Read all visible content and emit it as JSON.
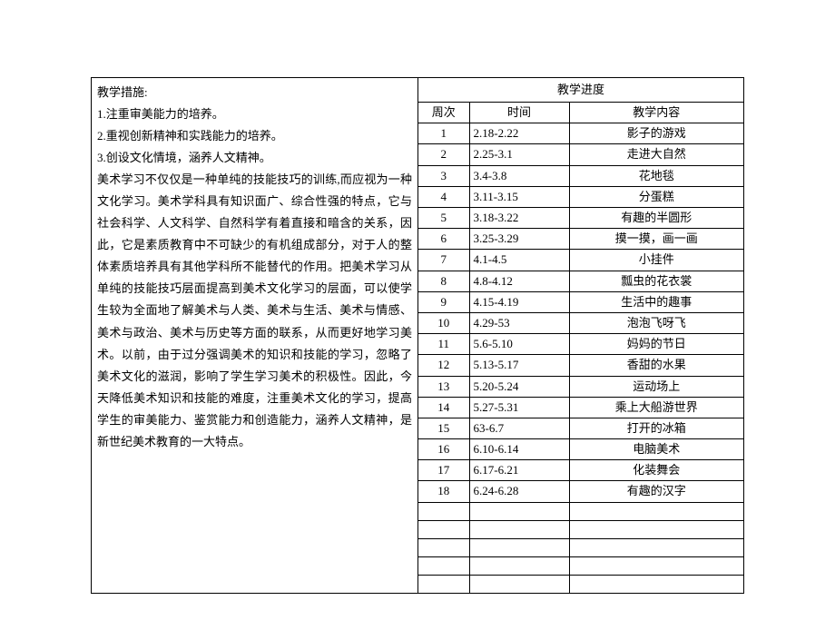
{
  "left": {
    "heading": "教学措施:",
    "point1": "1.注重审美能力的培养。",
    "point2": "2.重视创新精神和实践能力的培养。",
    "point3": "3.创设文化情境，涵养人文精神。",
    "para": "美术学习不仅仅是一种单纯的技能技巧的训练,而应视为一种文化学习。美术学科具有知识面广、综合性强的特点，它与社会科学、人文科学、自然科学有着直接和暗含的关系，因此，它是素质教育中不可缺少的有机组成部分，对于人的整体素质培养具有其他学科所不能替代的作用。把美术学习从单纯的技能技巧层面提高到美术文化学习的层面，可以使学生较为全面地了解美术与人类、美术与生活、美术与情感、美术与政治、美术与历史等方面的联系，从而更好地学习美术。以前，由于过分强调美术的知识和技能的学习，忽略了美术文化的滋润，影响了学生学习美术的积极性。因此，今天降低美术知识和技能的难度，注重美术文化的学习，提高学生的审美能力、鉴赏能力和创造能力，涵养人文精神，是新世纪美术教育的一大特点。"
  },
  "schedule": {
    "title": "教学进度",
    "headers": {
      "week": "周次",
      "time": "时间",
      "content": "教学内容"
    },
    "rows": [
      {
        "week": "1",
        "time": "2.18-2.22",
        "content": "影子的游戏"
      },
      {
        "week": "2",
        "time": "2.25-3.1",
        "content": "走进大自然"
      },
      {
        "week": "3",
        "time": "3.4-3.8",
        "content": "花地毯"
      },
      {
        "week": "4",
        "time": "3.11-3.15",
        "content": "分蛋糕"
      },
      {
        "week": "5",
        "time": "3.18-3.22",
        "content": "有趣的半圆形"
      },
      {
        "week": "6",
        "time": "3.25-3.29",
        "content": "摸一摸，画一画"
      },
      {
        "week": "7",
        "time": "4.1-4.5",
        "content": "小挂件"
      },
      {
        "week": "8",
        "time": "4.8-4.12",
        "content": "瓢虫的花衣裳"
      },
      {
        "week": "9",
        "time": "4.15-4.19",
        "content": "生活中的趣事"
      },
      {
        "week": "10",
        "time": "4.29-53",
        "content": "泡泡飞呀飞"
      },
      {
        "week": "11",
        "time": "5.6-5.10",
        "content": "妈妈的节日"
      },
      {
        "week": "12",
        "time": "5.13-5.17",
        "content": "香甜的水果"
      },
      {
        "week": "13",
        "time": "5.20-5.24",
        "content": "运动场上"
      },
      {
        "week": "14",
        "time": "5.27-5.31",
        "content": "乘上大船游世界"
      },
      {
        "week": "15",
        "time": "63-6.7",
        "content": "打开的冰箱"
      },
      {
        "week": "16",
        "time": "6.10-6.14",
        "content": "电脑美术"
      },
      {
        "week": "17",
        "time": "6.17-6.21",
        "content": "化装舞会"
      },
      {
        "week": "18",
        "time": "6.24-6.28",
        "content": "有趣的汉字"
      },
      {
        "week": "",
        "time": "",
        "content": ""
      },
      {
        "week": "",
        "time": "",
        "content": ""
      },
      {
        "week": "",
        "time": "",
        "content": ""
      },
      {
        "week": "",
        "time": "",
        "content": ""
      },
      {
        "week": "",
        "time": "",
        "content": ""
      }
    ]
  }
}
